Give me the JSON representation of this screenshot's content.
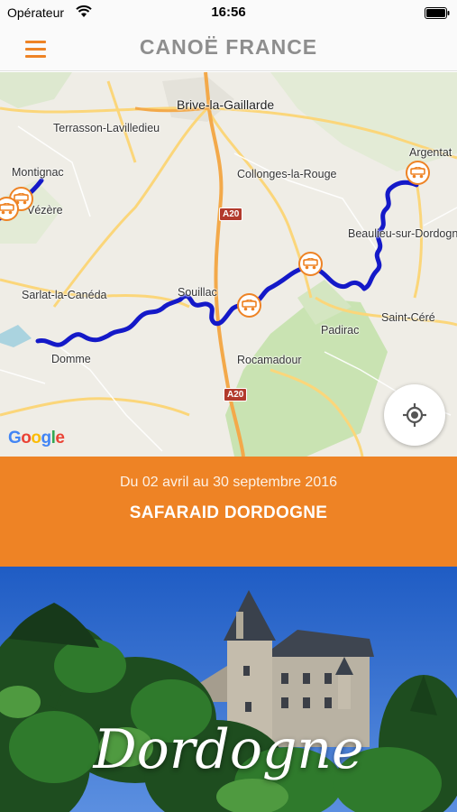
{
  "status_bar": {
    "carrier": "Opérateur",
    "time": "16:56",
    "icons": [
      "wifi-icon",
      "battery-icon"
    ]
  },
  "nav": {
    "brand": "CANOË FRANCE",
    "menu_icon": "hamburger-menu-icon",
    "accent_color": "#ee8325"
  },
  "map": {
    "labels": {
      "brive": "Brive-la-Gaillarde",
      "terrasson": "Terrasson-Lavilledieu",
      "argentat": "Argentat",
      "montignac": "Montignac",
      "collonges": "Collonges-la-Rouge",
      "vezere": "Vézère",
      "beaulieu": "Beaulieu-sur-Dordogne",
      "sarlat": "Sarlat-la-Canéda",
      "souillac": "Souillac",
      "saint_cere": "Saint-Céré",
      "padirac": "Padirac",
      "domme": "Domme",
      "rocamadour": "Rocamadour"
    },
    "road_shields": {
      "a20_north": "A20",
      "a20_south": "A20"
    },
    "attribution": "Google",
    "route_color": "#1419c8",
    "marker_icon": "canoe-station-icon",
    "locate_icon": "locate-me-icon"
  },
  "event": {
    "dates": "Du 02 avril au 30 septembre 2016",
    "title": "SAFARAID DORDOGNE",
    "background_color": "#ee8325"
  },
  "hero": {
    "title": "Dordogne",
    "image": "castle-above-forest-photo"
  }
}
